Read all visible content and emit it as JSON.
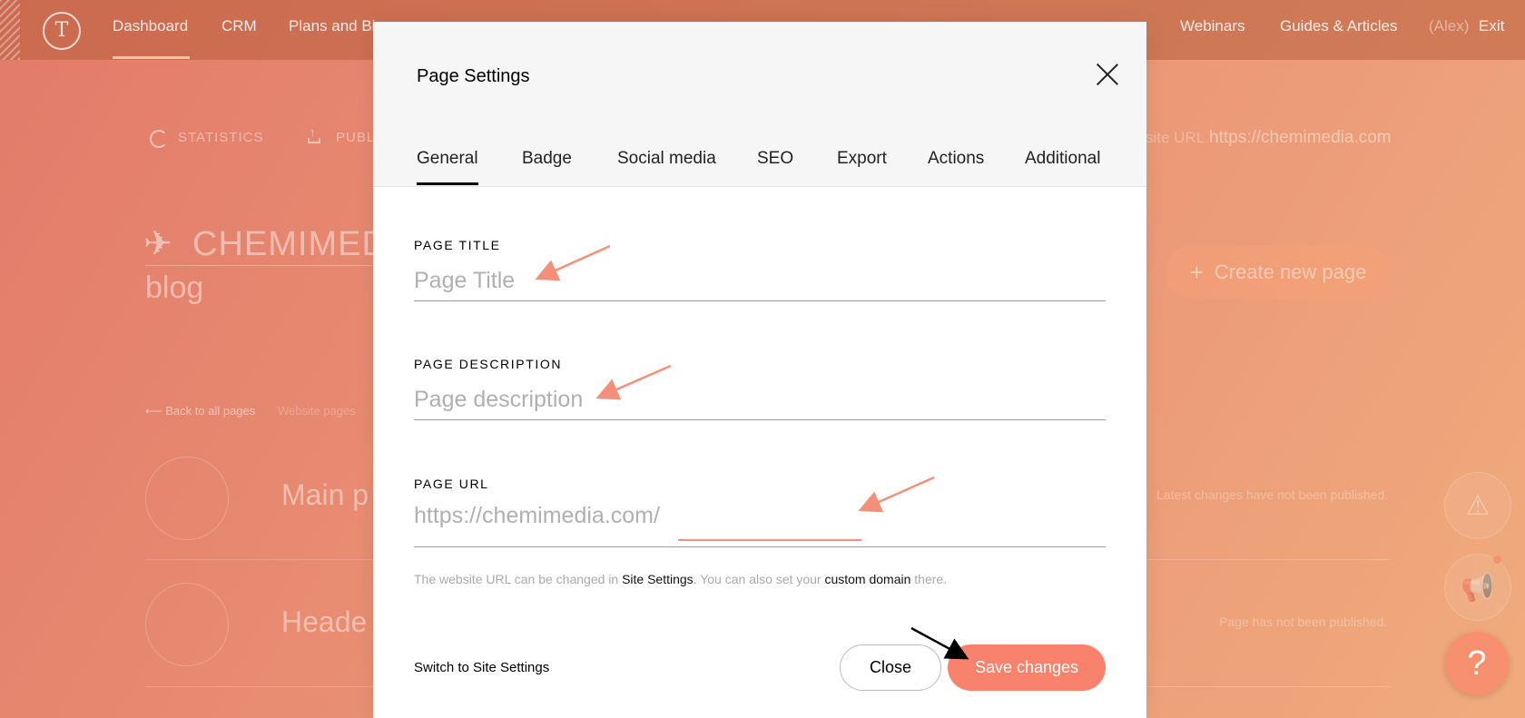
{
  "nav": {
    "logo": "T",
    "items": [
      "Dashboard",
      "CRM",
      "Plans and Bi",
      "Webinars",
      "Guides & Articles"
    ],
    "user": "(Alex)",
    "exit": "Exit"
  },
  "page": {
    "statistics": "STATISTICS",
    "publish": "PUBLI",
    "site_url_label": "site URL",
    "site_url": "https://chemimedia.com",
    "project_title": "CHEMIMED",
    "project_subtitle": "blog",
    "create_page": "Create new page",
    "back_link": "⟵ Back to all pages",
    "website_pages": "Website pages",
    "rows": [
      {
        "title": "Main p",
        "status": "Latest changes have not been published."
      },
      {
        "title": "Heade",
        "status": "Page has not been published."
      }
    ]
  },
  "modal": {
    "title": "Page Settings",
    "tabs": [
      "General",
      "Badge",
      "Social media",
      "SEO",
      "Export",
      "Actions",
      "Additional"
    ],
    "active_tab": "General",
    "fields": {
      "title_label": "PAGE TITLE",
      "title_placeholder": "Page Title",
      "description_label": "PAGE DESCRIPTION",
      "description_placeholder": "Page description",
      "url_label": "PAGE URL",
      "url_prefix": "https://chemimedia.com/"
    },
    "hint": {
      "part1": "The website URL can be changed in ",
      "link1": "Site Settings",
      "part2": ". You can also set your ",
      "link2": "custom domain",
      "part3": " there."
    },
    "switch_link": "Switch to Site Settings",
    "close_button": "Close",
    "save_button": "Save changes"
  },
  "colors": {
    "accent": "#f9826c",
    "annotation_arrow": "#f4907a"
  }
}
